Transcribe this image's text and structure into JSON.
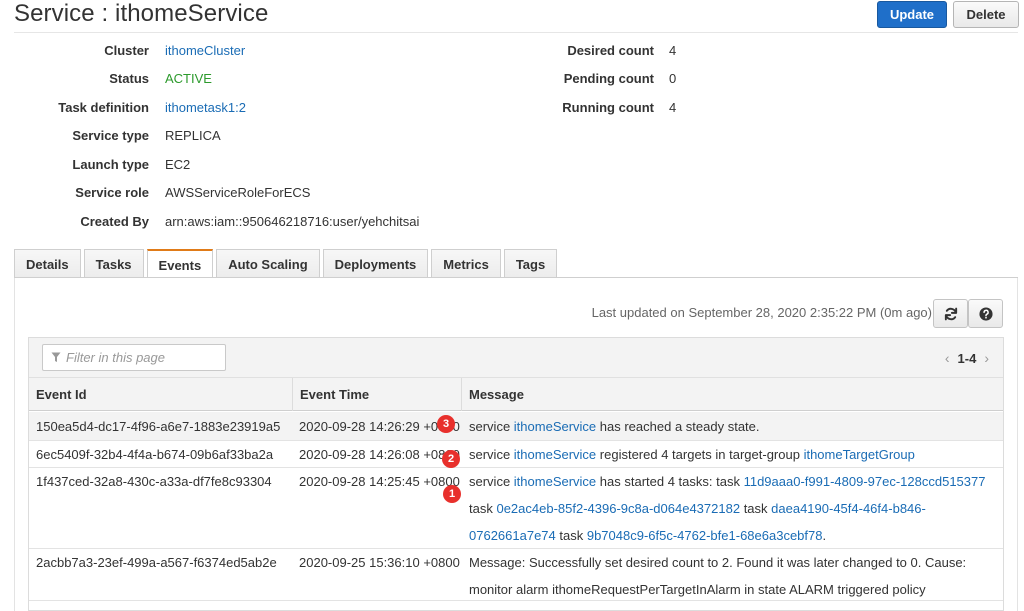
{
  "header": {
    "title": "Service : ithomeService",
    "update_label": "Update",
    "delete_label": "Delete"
  },
  "details": {
    "left": [
      {
        "label": "Cluster",
        "value": "ithomeCluster"
      },
      {
        "label": "Status",
        "value": "ACTIVE"
      },
      {
        "label": "Task definition",
        "value": "ithometask1:2"
      },
      {
        "label": "Service type",
        "value": "REPLICA"
      },
      {
        "label": "Launch type",
        "value": "EC2"
      },
      {
        "label": "Service role",
        "value": "AWSServiceRoleForECS"
      },
      {
        "label": "Created By",
        "value": "arn:aws:iam::950646218716:user/yehchitsai"
      }
    ],
    "right": [
      {
        "label": "Desired count",
        "value": "4"
      },
      {
        "label": "Pending count",
        "value": "0"
      },
      {
        "label": "Running count",
        "value": "4"
      }
    ]
  },
  "tabs": [
    "Details",
    "Tasks",
    "Events",
    "Auto Scaling",
    "Deployments",
    "Metrics",
    "Tags"
  ],
  "selected_tab": "Events",
  "events": {
    "last_updated": "Last updated on September 28, 2020 2:35:22 PM (0m ago)",
    "filter_placeholder": "Filter in this page",
    "page_range": "1-4",
    "columns": [
      "Event Id",
      "Event Time",
      "Message"
    ],
    "rows": [
      {
        "id": "150ea5d4-dc17-4f96-a6e7-1883e23919a5",
        "time": "2020-09-28 14:26:29 +0800",
        "message": {
          "t1": "service ",
          "l1": "ithomeService",
          "t2": " has reached a steady state."
        }
      },
      {
        "id": "6ec5409f-32b4-4f4a-b674-09b6af33ba2a",
        "time": "2020-09-28 14:26:08 +0800",
        "message": {
          "t1": "service ",
          "l1": "ithomeService",
          "t2": " registered 4 targets in target-group ",
          "l2": "ithomeTargetGroup"
        }
      },
      {
        "id": "1f437ced-32a8-430c-a33a-df7fe8c93304",
        "time": "2020-09-28 14:25:45 +0800",
        "message": {
          "t1": "service ",
          "l1": "ithomeService",
          "t2": " has started 4 tasks: task ",
          "l2": "11d9aaa0-f991-4809-97ec-128ccd515377",
          "t3": " task ",
          "l3": "0e2ac4eb-85f2-4396-9c8a-d064e4372182",
          "t4": " task ",
          "l4": "daea4190-45f4-46f4-b846-0762661a7e74",
          "t5": " task ",
          "l5": "9b7048c9-6f5c-4762-bfe1-68e6a3cebf78",
          "t6": "."
        }
      },
      {
        "id": "2acbb7a3-23ef-499a-a567-f6374ed5ab2e",
        "time": "2020-09-25 15:36:10 +0800",
        "message": {
          "t1": "Message: Successfully set desired count to 2. Found it was later changed to 0. Cause: monitor alarm ithomeRequestPerTargetInAlarm in state ALARM triggered policy ScaleInPolicy"
        }
      }
    ]
  },
  "annotations": [
    "3",
    "2",
    "1"
  ],
  "colors": {
    "primary_button": "#1f6fc9",
    "link": "#1a6cb5",
    "status_active": "#2c9a2c",
    "tab_accent": "#e07b18",
    "annotation_badge": "#e8302c"
  }
}
